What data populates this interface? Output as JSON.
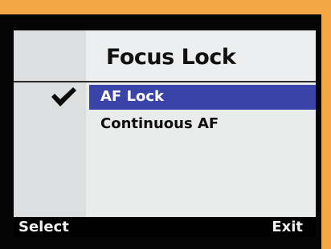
{
  "screen": {
    "title": "Focus Lock"
  },
  "menu": {
    "items": [
      {
        "label": "AF Lock",
        "checked": true,
        "selected": true
      },
      {
        "label": "Continuous AF",
        "checked": false,
        "selected": false
      }
    ]
  },
  "softkeys": {
    "left_label": "Select",
    "right_label": "Exit"
  },
  "icons": {
    "checkmark": "checkmark-icon"
  },
  "colors": {
    "highlight": "#3a44a8",
    "bezel": "#050505",
    "frame": "#f2a844"
  }
}
